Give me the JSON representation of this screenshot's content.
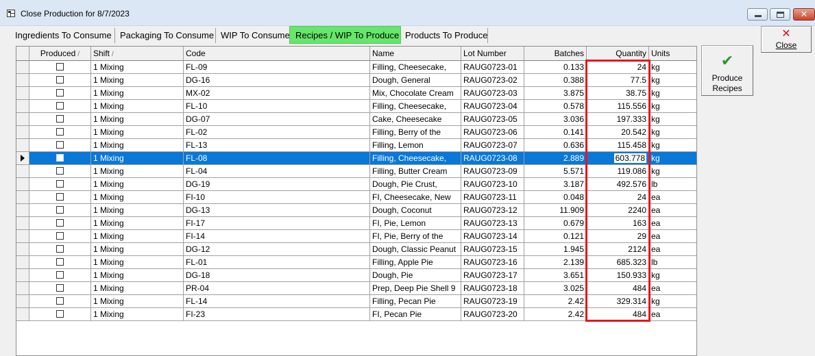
{
  "window": {
    "title": "Close Production for 8/7/2023",
    "min_icon": "minimize-icon",
    "max_icon": "maximize-icon",
    "close_glyph": "✕"
  },
  "tabs": [
    {
      "label": "Ingredients To Consume"
    },
    {
      "label": "Packaging To Consume"
    },
    {
      "label": "WIP To Consume"
    },
    {
      "label": "Recipes / WIP To Produce",
      "active": true
    },
    {
      "label": "Products To Produce"
    }
  ],
  "grid": {
    "columns": [
      "Produced",
      "Shift",
      "Code",
      "Name",
      "Lot Number",
      "Batches",
      "Quantity",
      "Units"
    ],
    "sort_glyph": "/",
    "selected_row": 7,
    "rows": [
      {
        "shift": "1 Mixing",
        "code": "FL-09",
        "name": "Filling, Cheesecake,",
        "lot": "RAUG0723-01",
        "batches": "0.133",
        "quantity": "24",
        "units": "kg"
      },
      {
        "shift": "1 Mixing",
        "code": "DG-16",
        "name": "Dough, General",
        "lot": "RAUG0723-02",
        "batches": "0.388",
        "quantity": "77.5",
        "units": "kg"
      },
      {
        "shift": "1 Mixing",
        "code": "MX-02",
        "name": "Mix, Chocolate Cream",
        "lot": "RAUG0723-03",
        "batches": "3.875",
        "quantity": "38.75",
        "units": "kg"
      },
      {
        "shift": "1 Mixing",
        "code": "FL-10",
        "name": "Filling, Cheesecake,",
        "lot": "RAUG0723-04",
        "batches": "0.578",
        "quantity": "115.556",
        "units": "kg"
      },
      {
        "shift": "1 Mixing",
        "code": "DG-07",
        "name": "Cake, Cheesecake",
        "lot": "RAUG0723-05",
        "batches": "3.036",
        "quantity": "197.333",
        "units": "kg"
      },
      {
        "shift": "1 Mixing",
        "code": "FL-02",
        "name": "Filling, Berry of the",
        "lot": "RAUG0723-06",
        "batches": "0.141",
        "quantity": "20.542",
        "units": "kg"
      },
      {
        "shift": "1 Mixing",
        "code": "FL-13",
        "name": "Filling, Lemon",
        "lot": "RAUG0723-07",
        "batches": "0.636",
        "quantity": "115.458",
        "units": "kg"
      },
      {
        "shift": "1 Mixing",
        "code": "FL-08",
        "name": "Filling, Cheesecake,",
        "lot": "RAUG0723-08",
        "batches": "2.889",
        "quantity": "603.778",
        "units": "kg"
      },
      {
        "shift": "1 Mixing",
        "code": "FL-04",
        "name": "Filling, Butter Cream",
        "lot": "RAUG0723-09",
        "batches": "5.571",
        "quantity": "119.086",
        "units": "kg"
      },
      {
        "shift": "1 Mixing",
        "code": "DG-19",
        "name": "Dough, Pie Crust,",
        "lot": "RAUG0723-10",
        "batches": "3.187",
        "quantity": "492.576",
        "units": "lb"
      },
      {
        "shift": "1 Mixing",
        "code": "FI-10",
        "name": "FI, Cheesecake, New",
        "lot": "RAUG0723-11",
        "batches": "0.048",
        "quantity": "24",
        "units": "ea"
      },
      {
        "shift": "1 Mixing",
        "code": "DG-13",
        "name": "Dough, Coconut",
        "lot": "RAUG0723-12",
        "batches": "11.909",
        "quantity": "2240",
        "units": "ea"
      },
      {
        "shift": "1 Mixing",
        "code": "FI-17",
        "name": "FI, Pie, Lemon",
        "lot": "RAUG0723-13",
        "batches": "0.679",
        "quantity": "163",
        "units": "ea"
      },
      {
        "shift": "1 Mixing",
        "code": "FI-14",
        "name": "FI, Pie, Berry of the",
        "lot": "RAUG0723-14",
        "batches": "0.121",
        "quantity": "29",
        "units": "ea"
      },
      {
        "shift": "1 Mixing",
        "code": "DG-12",
        "name": "Dough, Classic Peanut",
        "lot": "RAUG0723-15",
        "batches": "1.945",
        "quantity": "2124",
        "units": "ea"
      },
      {
        "shift": "1 Mixing",
        "code": "FL-01",
        "name": "Filling, Apple Pie",
        "lot": "RAUG0723-16",
        "batches": "2.139",
        "quantity": "685.323",
        "units": "lb"
      },
      {
        "shift": "1 Mixing",
        "code": "DG-18",
        "name": "Dough, Pie",
        "lot": "RAUG0723-17",
        "batches": "3.651",
        "quantity": "150.933",
        "units": "kg"
      },
      {
        "shift": "1 Mixing",
        "code": "PR-04",
        "name": "Prep, Deep Pie Shell 9",
        "lot": "RAUG0723-18",
        "batches": "3.025",
        "quantity": "484",
        "units": "ea"
      },
      {
        "shift": "1 Mixing",
        "code": "FL-14",
        "name": "Filling, Pecan Pie",
        "lot": "RAUG0723-19",
        "batches": "2.42",
        "quantity": "329.314",
        "units": "kg"
      },
      {
        "shift": "1 Mixing",
        "code": "FI-23",
        "name": "FI, Pecan Pie",
        "lot": "RAUG0723-20",
        "batches": "2.42",
        "quantity": "484",
        "units": "ea"
      }
    ]
  },
  "buttons": {
    "close_label": "Close",
    "close_icon": "x-icon",
    "produce_line1": "Produce",
    "produce_line2": "Recipes",
    "produce_icon": "checkmark-icon"
  },
  "colors": {
    "active_tab": "#66e66b",
    "selection": "#0a78d7",
    "highlight_box": "#e8161c"
  }
}
